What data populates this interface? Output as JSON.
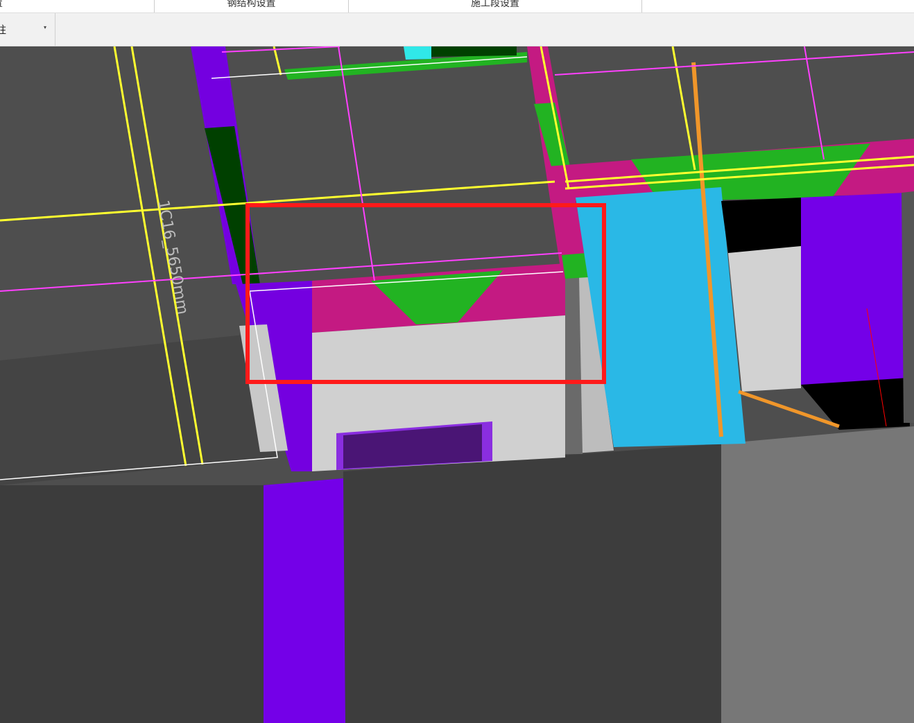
{
  "tabs": [
    {
      "label": "置"
    },
    {
      "label": "钢结构设置"
    },
    {
      "label": "施工段设置"
    }
  ],
  "toolbar": {
    "dropdown_value": "柱",
    "dropdown_arrow": "▾"
  },
  "viewport": {
    "dimension_label": "1C16_5650mm",
    "highlight_color": "#ff1a1a"
  }
}
